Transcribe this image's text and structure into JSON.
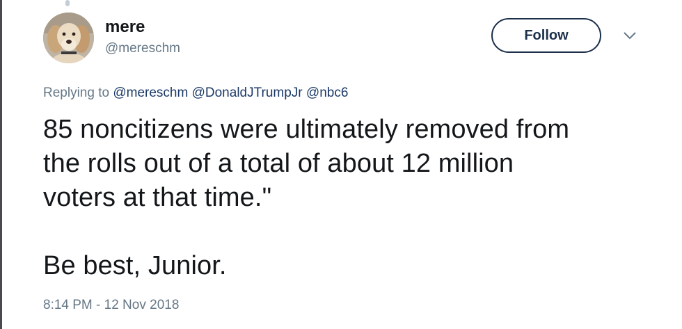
{
  "tweet": {
    "author": {
      "display_name": "mere",
      "handle": "@mereschm"
    },
    "follow_label": "Follow",
    "replying_to": {
      "prefix": "Replying to",
      "mentions": [
        "@mereschm",
        "@DonaldJTrumpJr",
        "@nbc6"
      ]
    },
    "text_lines": [
      "85 noncitizens were ultimately removed from",
      "the rolls out of a total of about 12 million",
      "voters at that time.\"",
      "Be best, Junior."
    ],
    "timestamp": "8:14 PM - 12 Nov 2018"
  },
  "colors": {
    "text": "#14171a",
    "secondary": "#657786",
    "mention": "#1b3966",
    "follow_border": "#1b2f4a"
  },
  "icons": {
    "caret": "chevron-down-icon",
    "avatar": "dog-avatar"
  }
}
